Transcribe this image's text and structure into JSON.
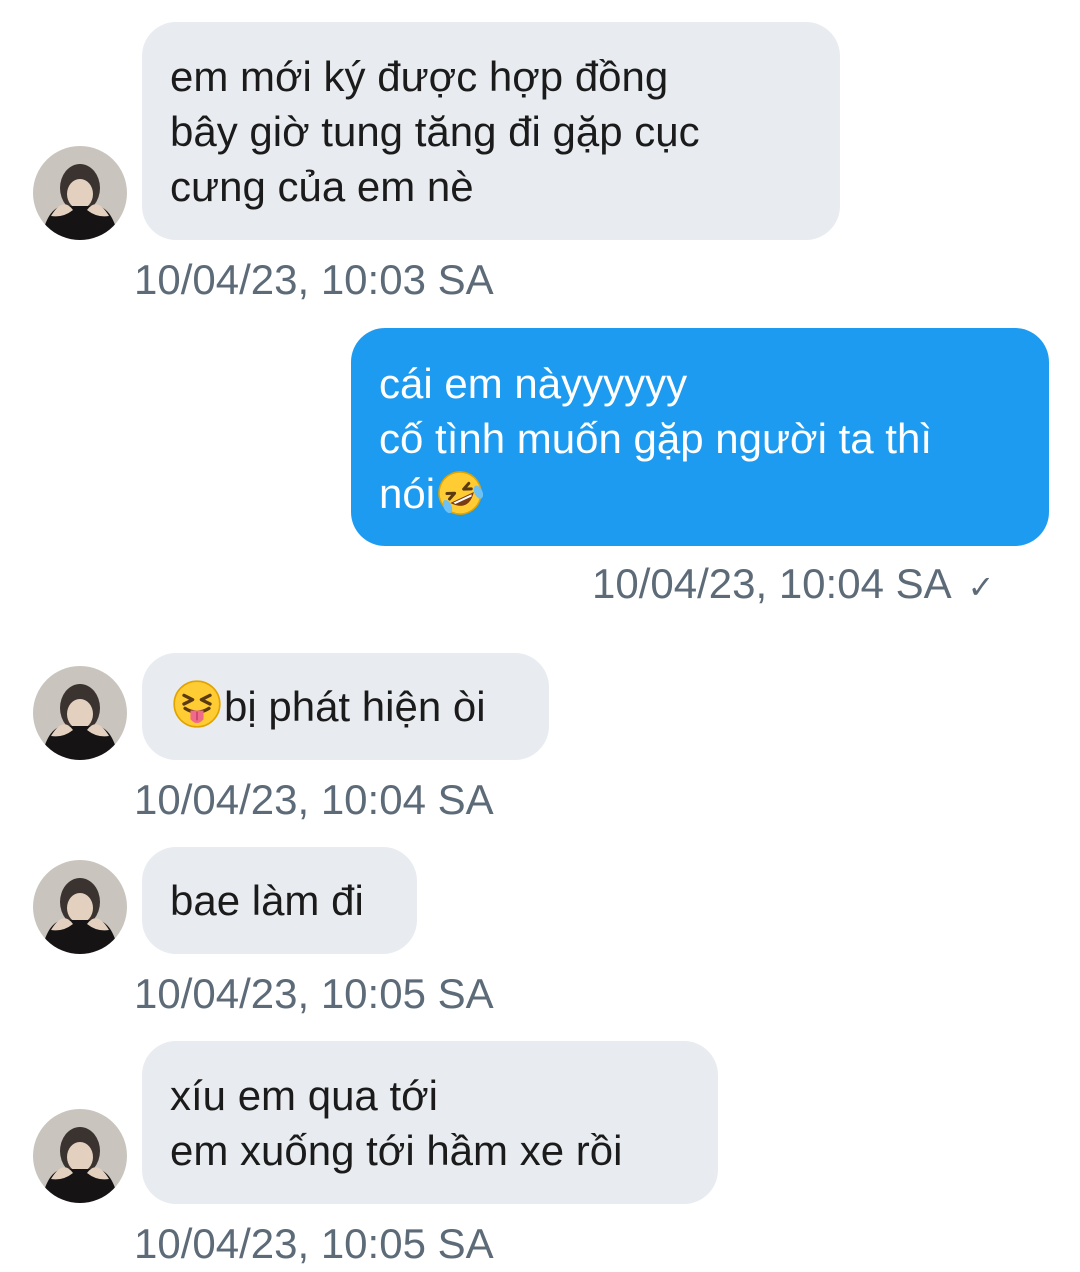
{
  "messages": [
    {
      "side": "in",
      "lines": [
        "em mới ký được hợp đồng",
        "bây giờ tung tăng đi gặp cục",
        "cưng của em nè"
      ],
      "time": "10/04/23, 10:03 SA"
    },
    {
      "side": "out",
      "lines": [
        "cái em nàyyyyyy",
        "cố tình muốn gặp người ta thì",
        "nói"
      ],
      "emoji": "rolling-on-floor-laughing-emoji",
      "time": "10/04/23, 10:04 SA",
      "status": "✓"
    },
    {
      "side": "in",
      "lines": [
        "bị phát hiện òi"
      ],
      "emoji": "squinting-tongue-emoji",
      "time": "10/04/23, 10:04 SA"
    },
    {
      "side": "in",
      "lines": [
        "bae làm đi"
      ],
      "time": "10/04/23, 10:05 SA"
    },
    {
      "side": "in",
      "lines": [
        "xíu em qua tới",
        "em xuống tới hầm xe rồi"
      ],
      "time": "10/04/23, 10:05 SA"
    }
  ],
  "colors": {
    "incoming_bubble": "#e8ecf0",
    "outgoing_bubble": "#1d9bf0",
    "timestamp": "#5d6b78"
  },
  "icons": {
    "avatar": "avatar-photo-icon",
    "read_status": "check-icon"
  }
}
